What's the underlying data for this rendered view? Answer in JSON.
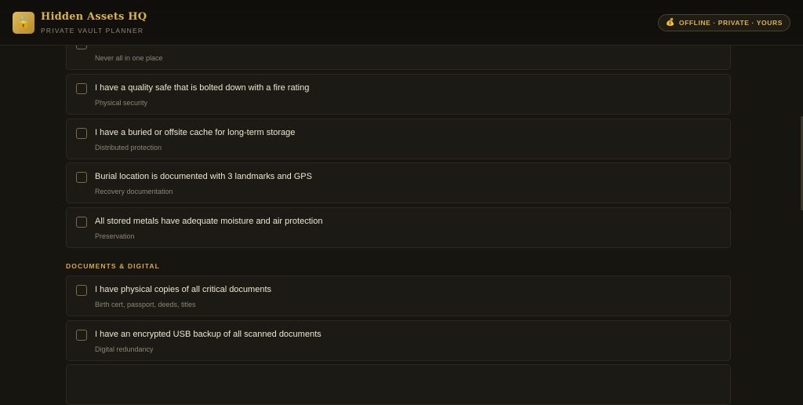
{
  "header": {
    "title": "Hidden Assets HQ",
    "subtitle": "PRIVATE VAULT PLANNER",
    "badge": "OFFLINE · PRIVATE · YOURS",
    "logo_icon": "lock-icon",
    "badge_icon": "vault-icon"
  },
  "storage_items": [
    {
      "title": "",
      "subtitle": "Never all in one place"
    },
    {
      "title": "I have a quality safe that is bolted down with a fire rating",
      "subtitle": "Physical security"
    },
    {
      "title": "I have a buried or offsite cache for long-term storage",
      "subtitle": "Distributed protection"
    },
    {
      "title": "Burial location is documented with 3 landmarks and GPS",
      "subtitle": "Recovery documentation"
    },
    {
      "title": "All stored metals have adequate moisture and air protection",
      "subtitle": "Preservation"
    }
  ],
  "documents_section": {
    "heading": "DOCUMENTS & DIGITAL",
    "items": [
      {
        "title": "I have physical copies of all critical documents",
        "subtitle": "Birth cert, passport, deeds, titles"
      },
      {
        "title": "I have an encrypted USB backup of all scanned documents",
        "subtitle": "Digital redundancy"
      }
    ]
  },
  "colors": {
    "accent": "#dcb24c",
    "background": "#16150f",
    "card": "#1b1a14"
  }
}
